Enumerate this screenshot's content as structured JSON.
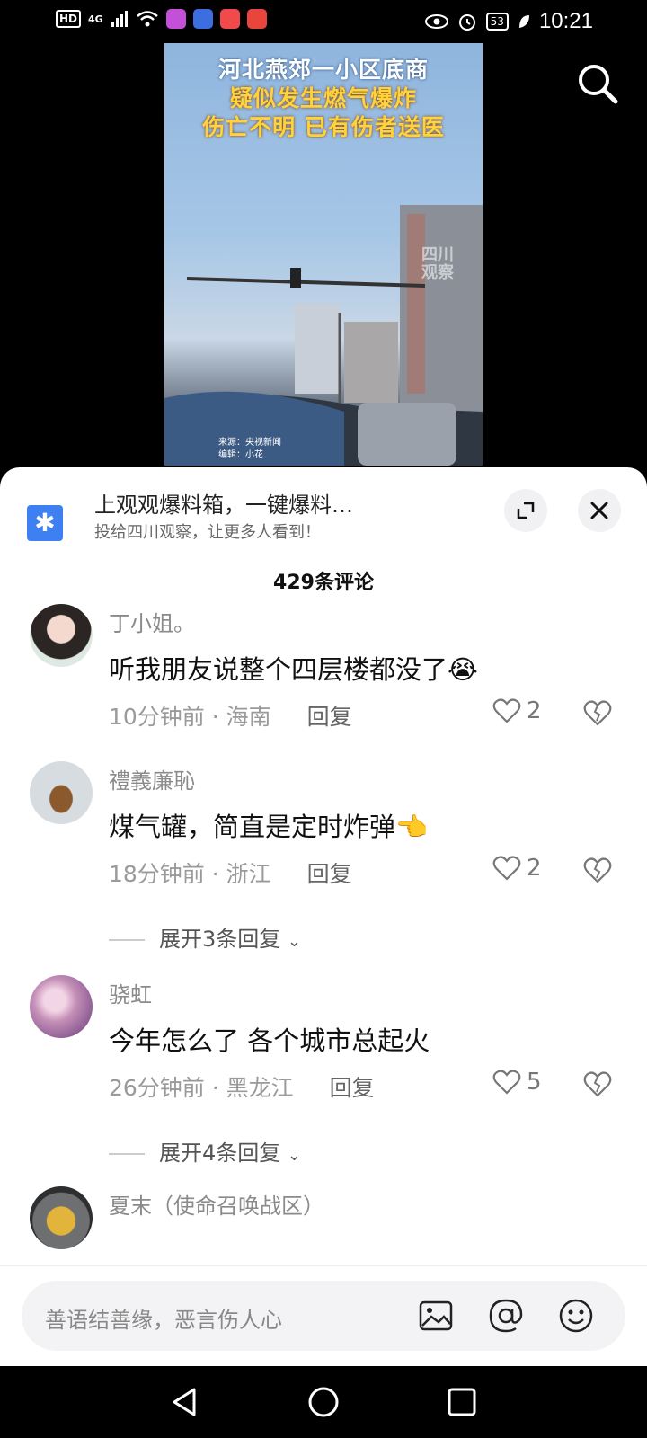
{
  "status_bar": {
    "left_badges": [
      "HD",
      "4G"
    ],
    "battery": "53",
    "time": "10:21",
    "app_icon_colors": [
      "#c44fd9",
      "#3d6ee0",
      "#f04a4a",
      "#e8463c"
    ]
  },
  "video": {
    "title_line1": "河北燕郊一小区底商",
    "title_line2": "疑似发生燃气爆炸",
    "title_line3": "伤亡不明 已有伤者送医",
    "source_line1": "来源：央视新闻",
    "source_line2": "编辑：小花",
    "watermark": "四川观察"
  },
  "banner": {
    "title": "上观观爆料箱，一键爆料…",
    "subtitle": "投给四川观察，让更多人看到！",
    "icon": "asterisk-icon",
    "accent": "#3e7ff2"
  },
  "comments_count": "429条评论",
  "comments": [
    {
      "user": "丁小姐。",
      "text": "听我朋友说整个四层楼都没了😭",
      "time": "10分钟前",
      "location": "海南",
      "reply": "回复",
      "likes": "2"
    },
    {
      "user": "禮義廉恥",
      "text": "煤气罐，简直是定时炸弹👈",
      "time": "18分钟前",
      "location": "浙江",
      "reply": "回复",
      "likes": "2",
      "expand": "展开3条回复"
    },
    {
      "user": "骁虹",
      "text": "今年怎么了 各个城市总起火",
      "time": "26分钟前",
      "location": "黑龙江",
      "reply": "回复",
      "likes": "5",
      "expand": "展开4条回复"
    },
    {
      "user": "夏末（使命召唤战区）"
    }
  ],
  "input": {
    "placeholder": "善语结善缘，恶言伤人心"
  }
}
